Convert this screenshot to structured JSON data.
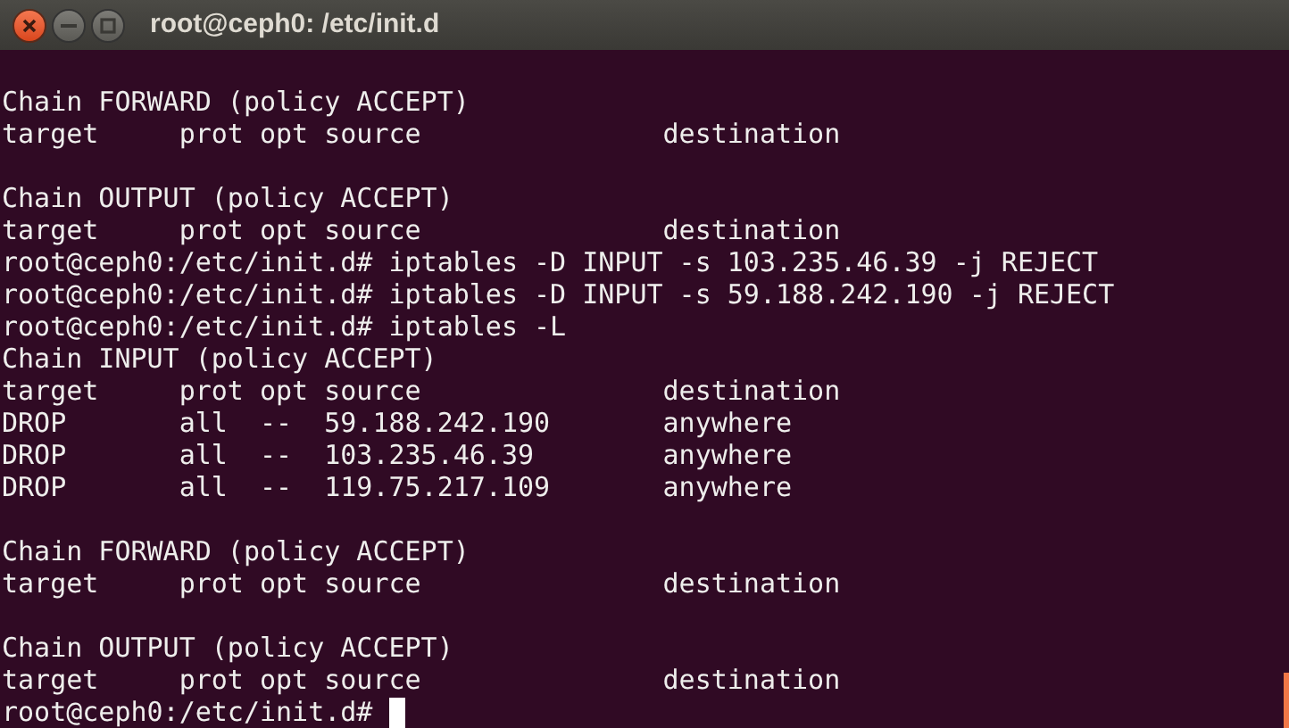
{
  "window": {
    "title": "root@ceph0: /etc/init.d"
  },
  "lines": [
    {
      "kind": "blank"
    },
    {
      "kind": "output",
      "text": "Chain FORWARD (policy ACCEPT)"
    },
    {
      "kind": "output",
      "text": "target     prot opt source               destination"
    },
    {
      "kind": "blank"
    },
    {
      "kind": "output",
      "text": "Chain OUTPUT (policy ACCEPT)"
    },
    {
      "kind": "output",
      "text": "target     prot opt source               destination"
    },
    {
      "kind": "output",
      "text": "root@ceph0:/etc/init.d# iptables -D INPUT -s 103.235.46.39 -j REJECT"
    },
    {
      "kind": "output",
      "text": "root@ceph0:/etc/init.d# iptables -D INPUT -s 59.188.242.190 -j REJECT"
    },
    {
      "kind": "output",
      "text": "root@ceph0:/etc/init.d# iptables -L"
    },
    {
      "kind": "output",
      "text": "Chain INPUT (policy ACCEPT)"
    },
    {
      "kind": "output",
      "text": "target     prot opt source               destination"
    },
    {
      "kind": "output",
      "text": "DROP       all  --  59.188.242.190       anywhere"
    },
    {
      "kind": "output",
      "text": "DROP       all  --  103.235.46.39        anywhere"
    },
    {
      "kind": "output",
      "text": "DROP       all  --  119.75.217.109       anywhere"
    },
    {
      "kind": "blank"
    },
    {
      "kind": "output",
      "text": "Chain FORWARD (policy ACCEPT)"
    },
    {
      "kind": "output",
      "text": "target     prot opt source               destination"
    },
    {
      "kind": "blank"
    },
    {
      "kind": "output",
      "text": "Chain OUTPUT (policy ACCEPT)"
    },
    {
      "kind": "output",
      "text": "target     prot opt source               destination"
    },
    {
      "kind": "prompt",
      "text": "root@ceph0:/etc/init.d#",
      "cursor": true
    }
  ]
}
